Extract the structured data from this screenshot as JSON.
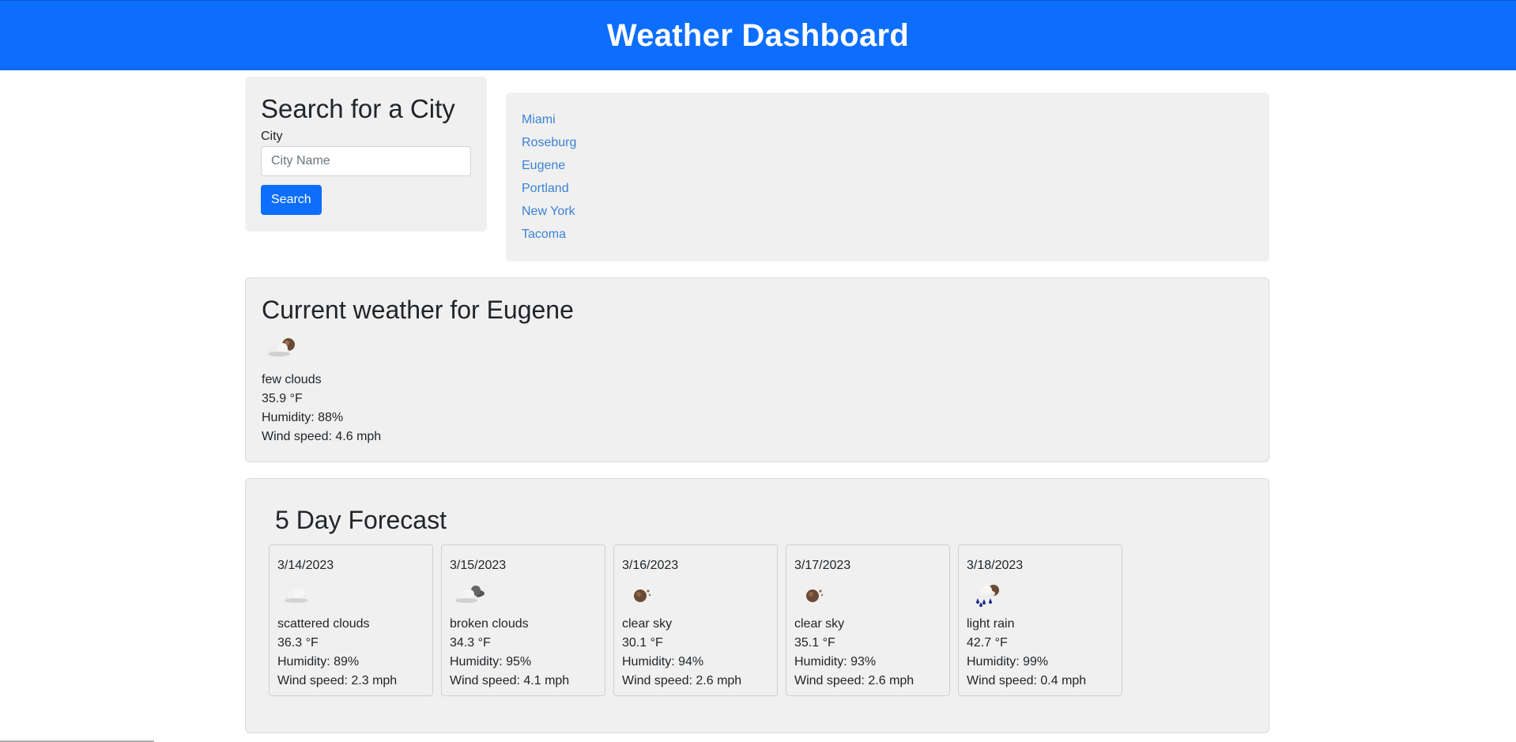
{
  "header": {
    "title": "Weather Dashboard"
  },
  "search": {
    "title": "Search for a City",
    "label": "City",
    "placeholder": "City Name",
    "button_label": "Search"
  },
  "history": {
    "items": [
      {
        "label": "Miami"
      },
      {
        "label": "Roseburg"
      },
      {
        "label": "Eugene"
      },
      {
        "label": "Portland"
      },
      {
        "label": "New York"
      },
      {
        "label": "Tacoma"
      }
    ]
  },
  "current": {
    "title": "Current weather for Eugene",
    "icon": "few-clouds-icon",
    "description": "few clouds",
    "temp": "35.9 °F",
    "humidity": "Humidity: 88%",
    "wind": "Wind speed: 4.6 mph"
  },
  "forecast": {
    "title": "5 Day Forecast",
    "days": [
      {
        "date": "3/14/2023",
        "icon": "scattered-clouds-icon",
        "description": "scattered clouds",
        "temp": "36.3 °F",
        "humidity": "Humidity: 89%",
        "wind": "Wind speed: 2.3 mph"
      },
      {
        "date": "3/15/2023",
        "icon": "broken-clouds-icon",
        "description": "broken clouds",
        "temp": "34.3 °F",
        "humidity": "Humidity: 95%",
        "wind": "Wind speed: 4.1 mph"
      },
      {
        "date": "3/16/2023",
        "icon": "clear-sky-night-icon",
        "description": "clear sky",
        "temp": "30.1 °F",
        "humidity": "Humidity: 94%",
        "wind": "Wind speed: 2.6 mph"
      },
      {
        "date": "3/17/2023",
        "icon": "clear-sky-night-icon",
        "description": "clear sky",
        "temp": "35.1 °F",
        "humidity": "Humidity: 93%",
        "wind": "Wind speed: 2.6 mph"
      },
      {
        "date": "3/18/2023",
        "icon": "light-rain-icon",
        "description": "light rain",
        "temp": "42.7 °F",
        "humidity": "Humidity: 99%",
        "wind": "Wind speed: 0.4 mph"
      }
    ]
  }
}
